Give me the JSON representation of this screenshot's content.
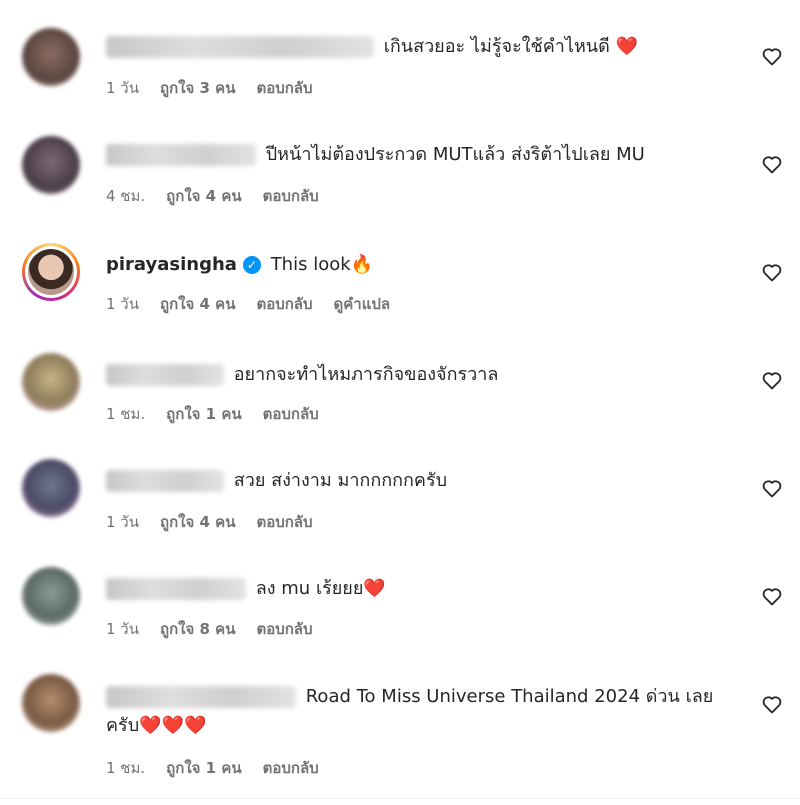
{
  "comments": [
    {
      "verified": false,
      "username": "",
      "text": "เกินสวยอะ ไม่รู้จะใช้คำไหนดี",
      "emoji": "❤️",
      "time": "1 วัน",
      "likes": "ถูกใจ 3 คน",
      "reply": "ตอบกลับ",
      "translate": ""
    },
    {
      "verified": false,
      "username": "",
      "text": "ปีหน้าไม่ต้องประกวด MUTแล้ว ส่งริต้าไปเลย MU",
      "emoji": "",
      "time": "4 ชม.",
      "likes": "ถูกใจ 4 คน",
      "reply": "ตอบกลับ",
      "translate": ""
    },
    {
      "verified": true,
      "username": "pirayasingha",
      "text": "This look",
      "emoji": "🔥",
      "time": "1 วัน",
      "likes": "ถูกใจ 4 คน",
      "reply": "ตอบกลับ",
      "translate": "ดูคำแปล"
    },
    {
      "verified": false,
      "username": "",
      "text": "อยากจะทำไหมภารกิจของจักรวาล",
      "emoji": "",
      "time": "1 ชม.",
      "likes": "ถูกใจ 1 คน",
      "reply": "ตอบกลับ",
      "translate": ""
    },
    {
      "verified": false,
      "username": "",
      "text": "สวย สง่างาม มากกกกกครับ",
      "emoji": "",
      "time": "1 วัน",
      "likes": "ถูกใจ 4 คน",
      "reply": "ตอบกลับ",
      "translate": ""
    },
    {
      "verified": false,
      "username": "",
      "text": "ลง mu เร้ยยย",
      "emoji": "❤️",
      "time": "1 วัน",
      "likes": "ถูกใจ 8 คน",
      "reply": "ตอบกลับ",
      "translate": ""
    },
    {
      "verified": false,
      "username": "",
      "text": "Road To Miss Universe Thailand 2024 ด่วน เลยครับ",
      "emoji": "❤️❤️❤️",
      "time": "1 ชม.",
      "likes": "ถูกใจ 1 คน",
      "reply": "ตอบกลับ",
      "translate": ""
    }
  ],
  "colors": {
    "text": "#262626",
    "meta": "#737373",
    "verified": "#0095f6",
    "heart_emoji": "#e0182d"
  },
  "icons": {
    "like": "heart-outline-icon",
    "verified": "verified-badge-icon"
  }
}
